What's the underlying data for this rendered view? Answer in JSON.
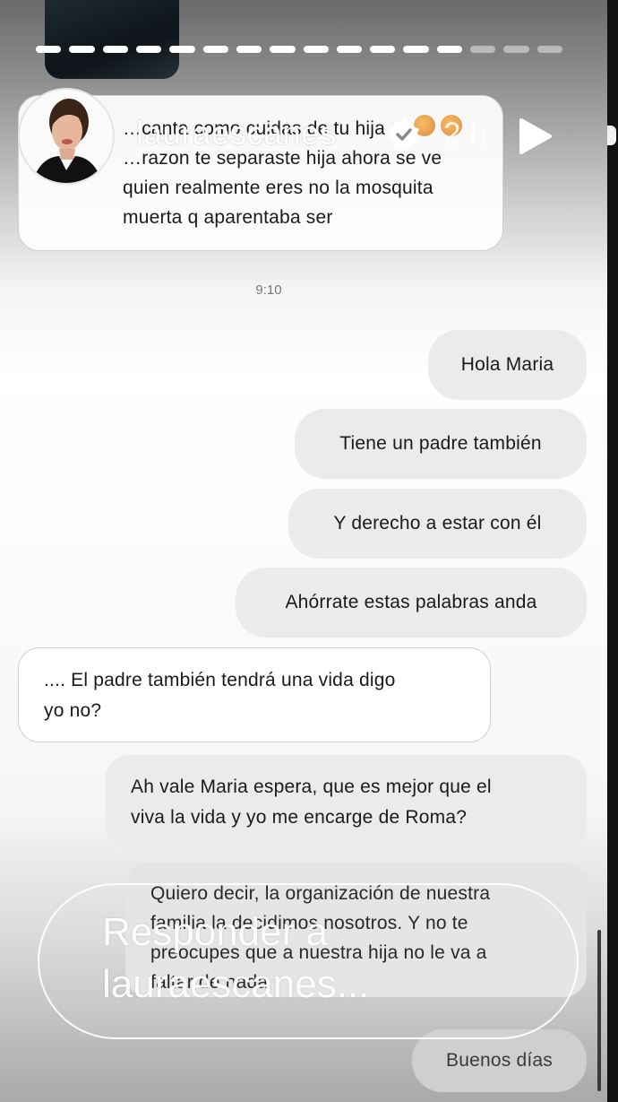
{
  "story": {
    "username": "lauraescanes",
    "time_ago": "2 h",
    "segments": [
      1,
      1,
      1,
      1,
      1,
      1,
      1,
      1,
      1,
      1,
      1,
      1,
      1,
      0,
      0,
      0
    ]
  },
  "chat": {
    "timestamp": "9:10",
    "messages": [
      {
        "dir": "in",
        "text": "…canta como cuidas de tu hija\n…razon te separaste hija ahora se ve\nquien realmente eres no la mosquita\nmuerta q aparentaba ser"
      },
      {
        "dir": "out",
        "text": "Hola Maria"
      },
      {
        "dir": "out",
        "text": "Tiene un padre también"
      },
      {
        "dir": "out",
        "text": "Y derecho a estar con él"
      },
      {
        "dir": "out",
        "text": "Ahórrate estas palabras anda"
      },
      {
        "dir": "in",
        "text": ".... El padre también tendrá una vida digo\nyo no?"
      },
      {
        "dir": "out",
        "text": "Ah vale Maria espera, que es mejor que el\nviva la vida y yo me encarge de Roma?"
      },
      {
        "dir": "out",
        "text": "Quiero decir, la organización de nuestra\nfamilia la decidimos nosotros. Y no te\npreocupes que a nuestra hija no le va a\nfaltar de nada"
      },
      {
        "dir": "out",
        "text": "Buenos días"
      }
    ]
  },
  "reply": {
    "placeholder": "Responder a lauraescanes..."
  }
}
